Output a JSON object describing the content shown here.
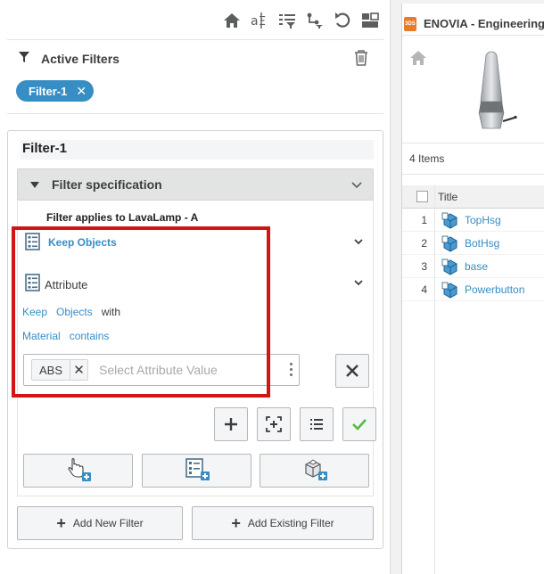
{
  "toolbar": {
    "icons": [
      "home-icon",
      "text-attribute-icon",
      "filter-list-icon",
      "structure-filter-icon",
      "undo-icon",
      "layout-toggle-icon"
    ]
  },
  "active_filters": {
    "title": "Active Filters",
    "chip_label": "Filter-1",
    "chip_remove": "✕"
  },
  "filter": {
    "title": "Filter-1",
    "spec_label": "Filter specification",
    "applies_to": "Filter applies to LavaLamp - A",
    "keep_objects_label": "Keep Objects",
    "attribute_label": "Attribute",
    "sentence1": [
      "Keep",
      "Objects",
      "with"
    ],
    "sentence2": [
      "Material",
      "contains"
    ],
    "value_tag": "ABS",
    "value_tag_remove": "✕",
    "value_placeholder": "Select Attribute Value",
    "clear_symbol": "✕"
  },
  "actions": {
    "add_new_filter": "Add New Filter",
    "add_existing_filter": "Add Existing Filter"
  },
  "right_panel": {
    "app_logo": "3DS",
    "app_title": "ENOVIA - Engineering",
    "items_count": "4 Items",
    "column_title": "Title",
    "rows": [
      {
        "num": "1",
        "name": "TopHsg"
      },
      {
        "num": "2",
        "name": "BotHsg"
      },
      {
        "num": "3",
        "name": "base"
      },
      {
        "num": "4",
        "name": "Powerbutton"
      }
    ]
  },
  "colors": {
    "accent": "#368ec4",
    "highlight": "#d11414",
    "confirm": "#57b847",
    "logo": "#e87b2a"
  }
}
